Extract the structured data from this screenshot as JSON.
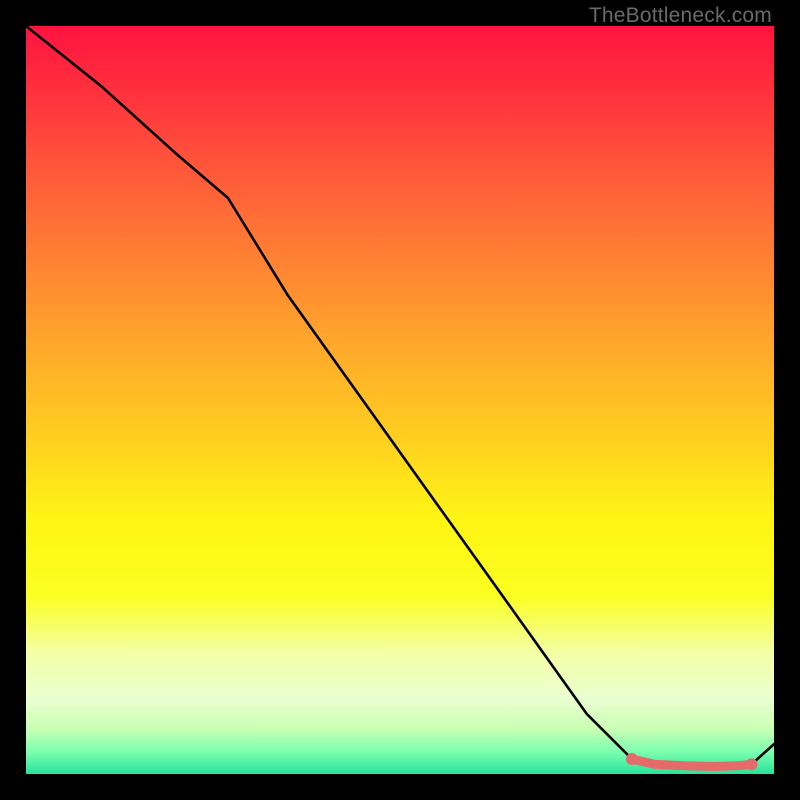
{
  "watermark": "TheBottleneck.com",
  "chart_data": {
    "type": "line",
    "title": "",
    "xlabel": "",
    "ylabel": "",
    "xlim": [
      0,
      100
    ],
    "ylim": [
      0,
      100
    ],
    "series": [
      {
        "name": "curve",
        "color": "#000000",
        "x": [
          0,
          10,
          20,
          27,
          35,
          45,
          55,
          65,
          75,
          81,
          84,
          88,
          92,
          95,
          97,
          100
        ],
        "y": [
          100,
          92,
          83,
          77,
          64,
          50,
          36,
          22,
          8,
          2,
          1.3,
          1.1,
          1.0,
          1.1,
          1.3,
          4
        ]
      }
    ],
    "markers": [
      {
        "name": "trough-start",
        "x": 81,
        "y": 2.0,
        "color": "#e56a6a"
      },
      {
        "name": "trough-end",
        "x": 97,
        "y": 1.3,
        "color": "#e56a6a"
      }
    ],
    "highlight_band": {
      "name": "optimal-range",
      "x_start": 81,
      "x_end": 97,
      "y": 1.3,
      "color": "#e56a6a"
    }
  }
}
